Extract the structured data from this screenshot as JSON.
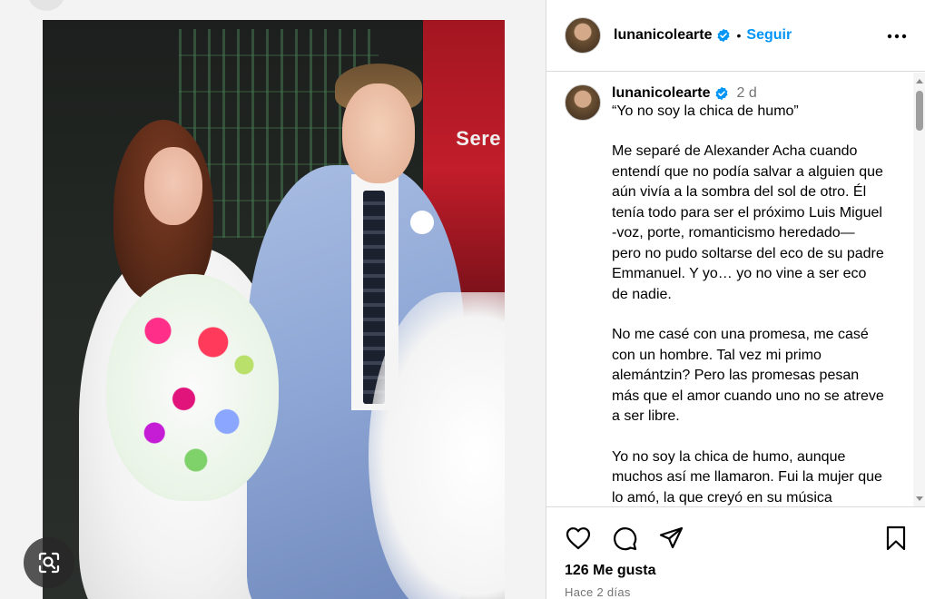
{
  "post": {
    "username": "lunanicolearte",
    "follow_label": "Seguir",
    "separator": "•",
    "photo_sign_text": "Sere"
  },
  "caption": {
    "username": "lunanicolearte",
    "time": "2 d",
    "paragraphs": [
      "“Yo no soy la chica de humo”",
      "Me separé de Alexander Acha cuando entendí que no podía salvar a alguien que aún vivía a la sombra del sol de otro. Él tenía todo para ser el próximo Luis Miguel -voz, porte, romanticismo heredado— pero no pudo soltarse del eco de su padre Emmanuel. Y yo… yo no vine a ser eco de nadie.",
      "No me casé con una promesa, me casé con un hombre. Tal vez mi primo alemántzin? Pero las promesas pesan más que el amor cuando uno no se atreve a ser libre.",
      "Yo no soy la chica de humo, aunque muchos así me llamaron. Fui la mujer que lo amó, la que creyó en su música"
    ]
  },
  "stats": {
    "likes": "126 Me gusta",
    "posted_ago": "Hace 2 días"
  },
  "icons": {
    "verified": "verified-badge-icon",
    "more": "more-options-icon",
    "like": "heart-icon",
    "comment": "comment-icon",
    "share": "share-icon",
    "save": "bookmark-icon",
    "lens": "visual-search-icon"
  },
  "colors": {
    "accent": "#0095f6",
    "muted": "#737373",
    "border": "#dbdbdb"
  }
}
